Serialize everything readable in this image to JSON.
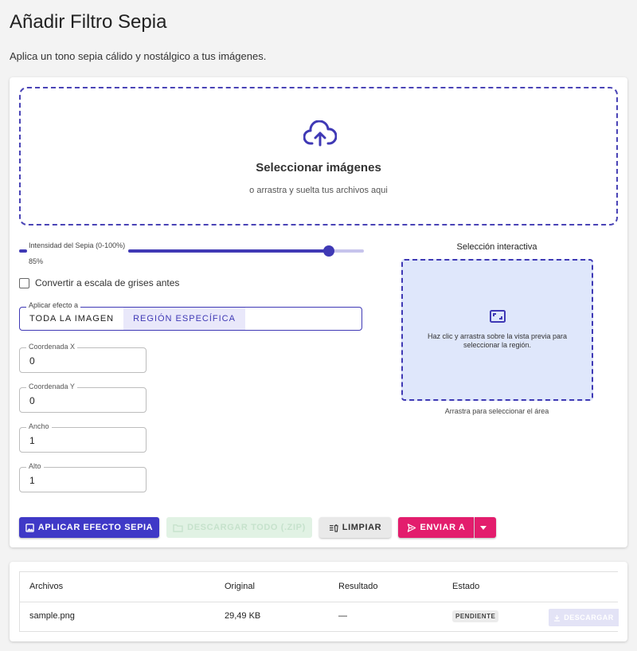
{
  "page": {
    "title": "Añadir Filtro Sepia",
    "description": "Aplica un tono sepia cálido y nostálgico a tus imágenes."
  },
  "dropzone": {
    "title": "Seleccionar imágenes",
    "subtitle": "o arrastra y suelta tus archivos aqui",
    "icon": "cloud-upload-icon"
  },
  "slider": {
    "label": "Intensidad del Sepia (0-100%)",
    "value_text": "85%",
    "value_percent": 85
  },
  "checkbox": {
    "label": "Convertir a escala de grises antes",
    "checked": false
  },
  "apply_to": {
    "legend": "Aplicar efecto a",
    "options": [
      "TODA LA IMAGEN",
      "REGIÓN ESPECÍFICA"
    ],
    "selected": "REGIÓN ESPECÍFICA"
  },
  "fields": {
    "x": {
      "label": "Coordenada X",
      "value": "0"
    },
    "y": {
      "label": "Coordenada Y",
      "value": "0"
    },
    "width": {
      "label": "Ancho",
      "value": "1"
    },
    "height": {
      "label": "Alto",
      "value": "1"
    }
  },
  "selection": {
    "title": "Selección interactiva",
    "hint": "Haz clic y arrastra sobre la vista previa para seleccionar la región.",
    "caption": "Arrastra para seleccionar el área",
    "icon": "select-region-icon"
  },
  "actions": {
    "apply": "APLICAR EFECTO SEPIA",
    "download_all": "DESCARGAR TODO (.ZIP)",
    "clear": "LIMPIAR",
    "send": "ENVIAR A"
  },
  "table": {
    "headers": [
      "Archivos",
      "Original",
      "Resultado",
      "Estado"
    ],
    "rows": [
      {
        "file": "sample.png",
        "original": "29,49 KB",
        "result": "—",
        "status": "PENDIENTE",
        "action": "DESCARGAR"
      }
    ]
  },
  "colors": {
    "primary": "#3f39c7",
    "accent": "#e31d6d",
    "selection_bg": "#dfe7fb"
  }
}
